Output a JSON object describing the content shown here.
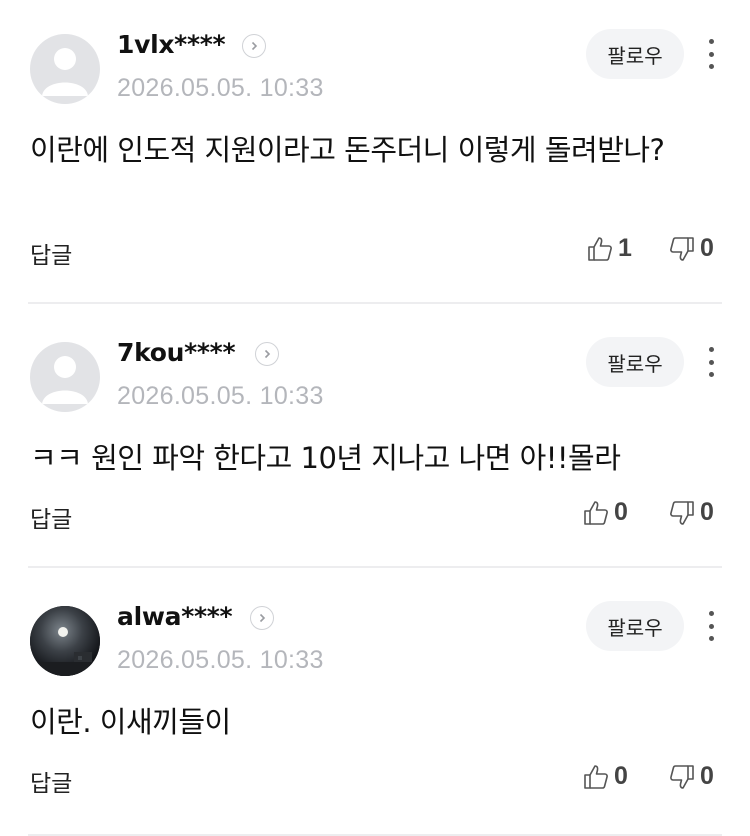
{
  "comments": [
    {
      "username": "1vlx****",
      "timestamp": "2026.05.05. 10:33",
      "follow_label": "팔로우",
      "text": "이란에 인도적 지원이라고 돈주더니 이렇게 돌려받나?",
      "reply_label": "답글",
      "likes": "1",
      "dislikes": "0",
      "avatar": "default-avatar-icon"
    },
    {
      "username": "7kou****",
      "timestamp": "2026.05.05. 10:33",
      "follow_label": "팔로우",
      "text": "ㅋㅋ 원인 파악 한다고 10년 지나고 나면 아!!몰라",
      "reply_label": "답글",
      "likes": "0",
      "dislikes": "0",
      "avatar": "default-avatar-icon"
    },
    {
      "username": "alwa****",
      "timestamp": "2026.05.05. 10:33",
      "follow_label": "팔로우",
      "text": "이란. 이새끼들이",
      "reply_label": "답글",
      "likes": "0",
      "dislikes": "0",
      "avatar": "moon-photo-avatar"
    }
  ],
  "colors": {
    "timestamp": "#b4b6bb",
    "follow_bg": "#f3f4f6",
    "divider": "#ededef",
    "avatar_placeholder": "#e2e3e6"
  }
}
